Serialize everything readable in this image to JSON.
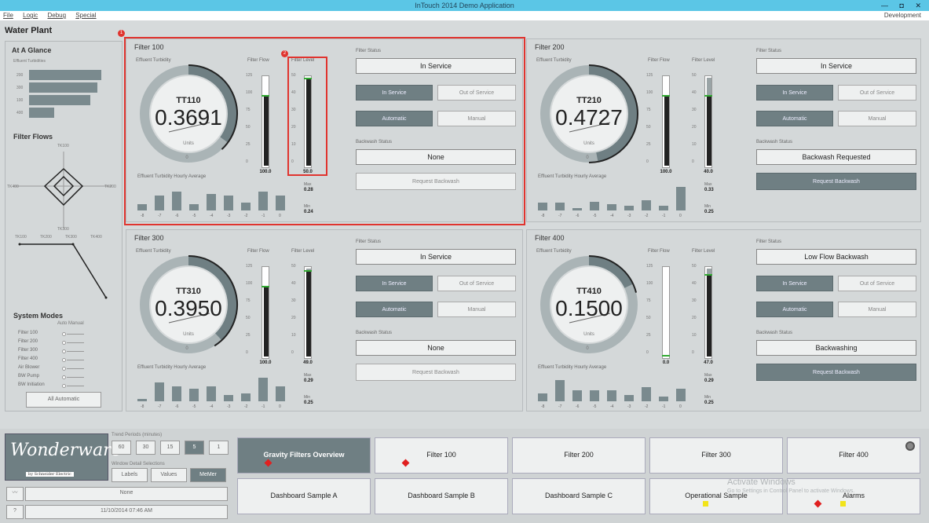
{
  "window": {
    "title": "InTouch 2014 Demo Application",
    "controls": "— ◘ ✕"
  },
  "menu": {
    "file": "File",
    "logic": "Logic",
    "debug": "Debug",
    "special": "Special",
    "mode": "Development"
  },
  "page_title": "Water Plant",
  "at_a_glance": {
    "title": "At A Glance",
    "turbidities_label": "Effluent Turbidities",
    "rows": [
      {
        "label": "200",
        "fraction": 1.0
      },
      {
        "label": "300",
        "fraction": 0.95
      },
      {
        "label": "100",
        "fraction": 0.85
      },
      {
        "label": "400",
        "fraction": 0.35
      }
    ],
    "flows_title": "Filter Flows",
    "flow_labels": {
      "top": "TK100",
      "left": "TK400",
      "right": "TK200",
      "bottom": "TK300"
    },
    "trend_labels": [
      "TK100",
      "TK200",
      "TK300",
      "TK400"
    ]
  },
  "system_modes": {
    "title": "System Modes",
    "header": "Auto Manual",
    "rows": [
      "Filter 100",
      "Filter 200",
      "Filter 300",
      "Filter 400",
      "Air Blower",
      "BW Pump",
      "BW Initiation"
    ],
    "all_auto": "All Automatic"
  },
  "labels": {
    "eff_turb": "Effluent Turbidity",
    "filter_flow": "Filter Flow",
    "filter_level": "Filter Level",
    "filter_status": "Filter Status",
    "backwash_status": "Backwash Status",
    "hourly_avg": "Effluent Turbidity Hourly Average",
    "units": "Units",
    "in_service_btn": "In Service",
    "out_service_btn": "Out of Service",
    "automatic_btn": "Automatic",
    "manual_btn": "Manual",
    "request_backwash": "Request Backwash",
    "max": "Max",
    "min": "Min",
    "flow_ticks": [
      "125",
      "100",
      "75",
      "50",
      "25",
      "0"
    ],
    "level_ticks": [
      "50",
      "40",
      "30",
      "20",
      "10",
      "0"
    ],
    "hours": [
      "-8",
      "-7",
      "-6",
      "-5",
      "-4",
      "-3",
      "-2",
      "-1",
      "0"
    ],
    "gauge_zero": "0"
  },
  "filters": [
    {
      "title": "Filter 100",
      "tag": "TT110",
      "value": "0.3691",
      "flow": "100.0",
      "flow_frac": 0.8,
      "level": "50.0",
      "level_frac": 1.0,
      "status": "In Service",
      "backwash": "None",
      "max": "0.28",
      "min": "0.24",
      "hist": [
        0.25,
        0.6,
        0.75,
        0.25,
        0.65,
        0.6,
        0.3,
        0.75,
        0.6
      ],
      "gauge_frac": 0.35,
      "bw_active": false
    },
    {
      "title": "Filter 200",
      "tag": "TT210",
      "value": "0.4727",
      "flow": "100.0",
      "flow_frac": 0.8,
      "level": "40.0",
      "level_frac": 0.8,
      "status": "In Service",
      "backwash": "Backwash Requested",
      "max": "0.33",
      "min": "0.25",
      "hist": [
        0.3,
        0.3,
        0.1,
        0.35,
        0.25,
        0.2,
        0.4,
        0.2,
        0.95
      ],
      "gauge_frac": 0.47,
      "bw_active": true
    },
    {
      "title": "Filter 300",
      "tag": "TT310",
      "value": "0.3950",
      "flow": "100.0",
      "flow_frac": 0.8,
      "level": "49.0",
      "level_frac": 0.98,
      "status": "In Service",
      "backwash": "None",
      "max": "0.29",
      "min": "0.25",
      "hist": [
        0.1,
        0.75,
        0.6,
        0.5,
        0.6,
        0.25,
        0.3,
        0.95,
        0.6
      ],
      "gauge_frac": 0.38,
      "bw_active": false
    },
    {
      "title": "Filter 400",
      "tag": "TT410",
      "value": "0.1500",
      "flow": "0.0",
      "flow_frac": 0.0,
      "level": "47.0",
      "level_frac": 0.94,
      "status": "Low Flow Backwash",
      "backwash": "Backwashing",
      "max": "0.29",
      "min": "0.25",
      "hist": [
        0.3,
        0.85,
        0.45,
        0.45,
        0.45,
        0.25,
        0.55,
        0.2,
        0.5
      ],
      "gauge_frac": 0.18,
      "bw_active": true
    }
  ],
  "trend_controls": {
    "period_label": "Trend Periods (minutes)",
    "periods": [
      "60",
      "30",
      "15",
      "5",
      "1"
    ],
    "active_period": "5",
    "detail_label": "Window Detail Selections",
    "details": [
      "Labels",
      "Values",
      "MeMer"
    ],
    "active_detail": "MeMer",
    "alarm_text": "None",
    "datetime": "11/10/2014 07:46 AM"
  },
  "logo": {
    "brand": "Wonderware",
    "sub": "by Schneider Electric"
  },
  "nav": [
    "Gravity Filters Overview",
    "Filter 100",
    "Filter 200",
    "Filter 300",
    "Filter 400",
    "Dashboard Sample A",
    "Dashboard Sample B",
    "Dashboard Sample C",
    "Operational Sample",
    "Alarms"
  ],
  "watermark": {
    "line1": "Activate Windows",
    "line2": "Go to Settings in Control Panel to activate Windows."
  },
  "colors": {
    "accent": "#6f7f83",
    "highlight": "#e0342f",
    "titlebar": "#5bc6e6"
  },
  "callouts": [
    "1",
    "2"
  ]
}
